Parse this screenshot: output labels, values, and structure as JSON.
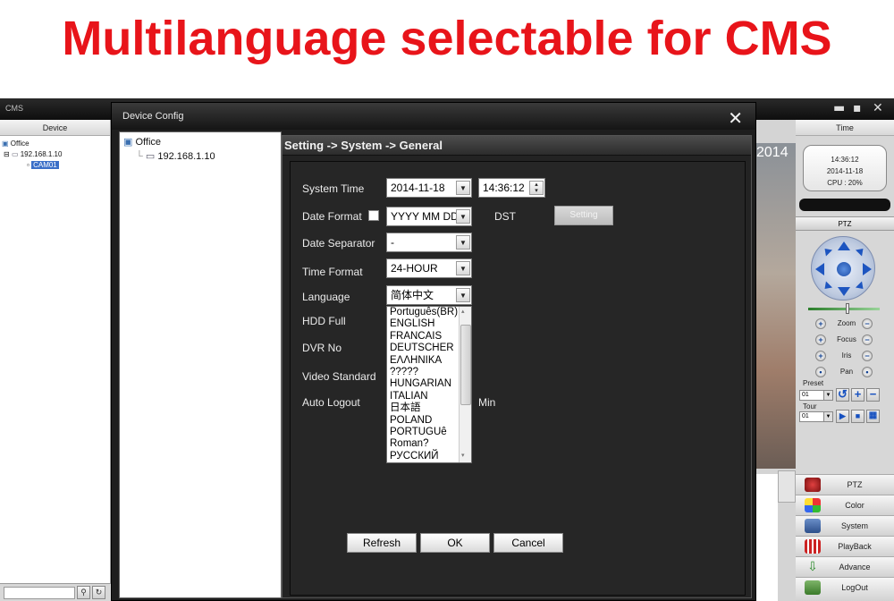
{
  "banner": {
    "title": "Multilanguage selectable for CMS"
  },
  "cms": {
    "title": "CMS",
    "device_header": "Device",
    "time_header": "Time",
    "tree": {
      "root": "Office",
      "device": "192.168.1.10",
      "camera": "CAM01"
    }
  },
  "right_panel": {
    "clock_time": "14:36:12",
    "clock_date": "2014-11-18",
    "cpu": "CPU : 20%",
    "ptz_header": "PTZ",
    "controls": [
      "Zoom",
      "Focus",
      "Iris",
      "Pan"
    ],
    "preset_label": "Preset",
    "preset_value": "01",
    "tour_label": "Tour",
    "tour_value": "01",
    "menu": [
      "PTZ",
      "Color",
      "System",
      "PlayBack",
      "Advance",
      "LogOut"
    ]
  },
  "video": {
    "year_text": "2014"
  },
  "dialog": {
    "title": "Device Config",
    "close": "✕",
    "tree": {
      "root": "Office",
      "device": "192.168.1.10"
    },
    "heading": "Setting -> System -> General",
    "labels": {
      "system_time": "System Time",
      "date_format": "Date Format",
      "date_separator": "Date Separator",
      "time_format": "Time Format",
      "language": "Language",
      "hdd_full": "HDD Full",
      "dvr_no": "DVR No",
      "video_standard": "Video Standard",
      "auto_logout": "Auto Logout",
      "dst": "DST",
      "min": "Min"
    },
    "values": {
      "date": "2014-11-18",
      "time": "14:36:12",
      "date_format": "YYYY MM DD",
      "date_separator": "-",
      "time_format": "24-HOUR",
      "language": "简体中文"
    },
    "setting_button": "Setting",
    "language_options": [
      "Português(BR)",
      "ENGLISH",
      "FRANCAIS",
      "DEUTSCHER",
      "ΕΛΛΗΝΙΚΑ",
      "?????",
      "HUNGARIAN",
      "ITALIAN",
      "日本語",
      "POLAND",
      "PORTUGUê",
      "Roman?",
      "РУССКИЙ"
    ],
    "buttons": {
      "refresh": "Refresh",
      "ok": "OK",
      "cancel": "Cancel"
    }
  }
}
